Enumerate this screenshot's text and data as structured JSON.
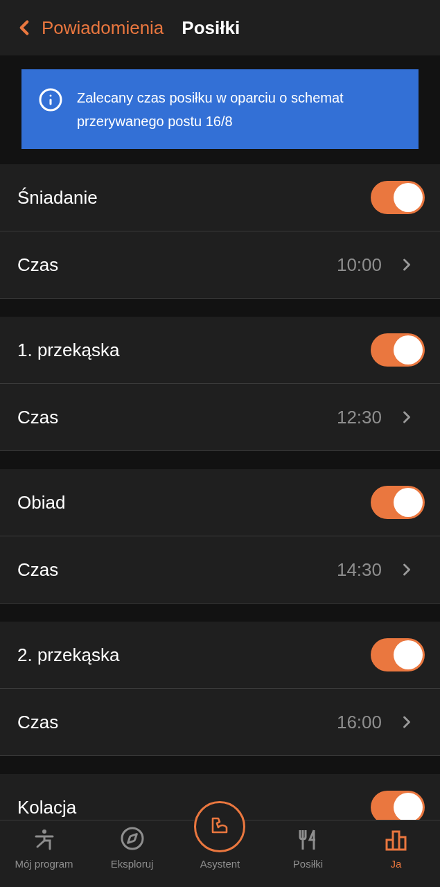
{
  "header": {
    "back_label": "Powiadomienia",
    "title": "Posiłki"
  },
  "banner": {
    "text": "Zalecany czas posiłku w oparciu o schemat przerywanego postu 16/8"
  },
  "meals": [
    {
      "name": "Śniadanie",
      "on": true,
      "time_label": "Czas",
      "time": "10:00"
    },
    {
      "name": "1. przekąska",
      "on": true,
      "time_label": "Czas",
      "time": "12:30"
    },
    {
      "name": "Obiad",
      "on": true,
      "time_label": "Czas",
      "time": "14:30"
    },
    {
      "name": "2. przekąska",
      "on": true,
      "time_label": "Czas",
      "time": "16:00"
    },
    {
      "name": "Kolacja",
      "on": true
    }
  ],
  "tab_bar": [
    {
      "label": "Mój program",
      "kind": "program",
      "selected": false
    },
    {
      "label": "Eksploruj",
      "kind": "explore",
      "selected": false
    },
    {
      "label": "Asystent",
      "kind": "assistant",
      "selected": false
    },
    {
      "label": "Posiłki",
      "kind": "meals",
      "selected": false
    },
    {
      "label": "Ja",
      "kind": "me",
      "selected": true
    }
  ]
}
